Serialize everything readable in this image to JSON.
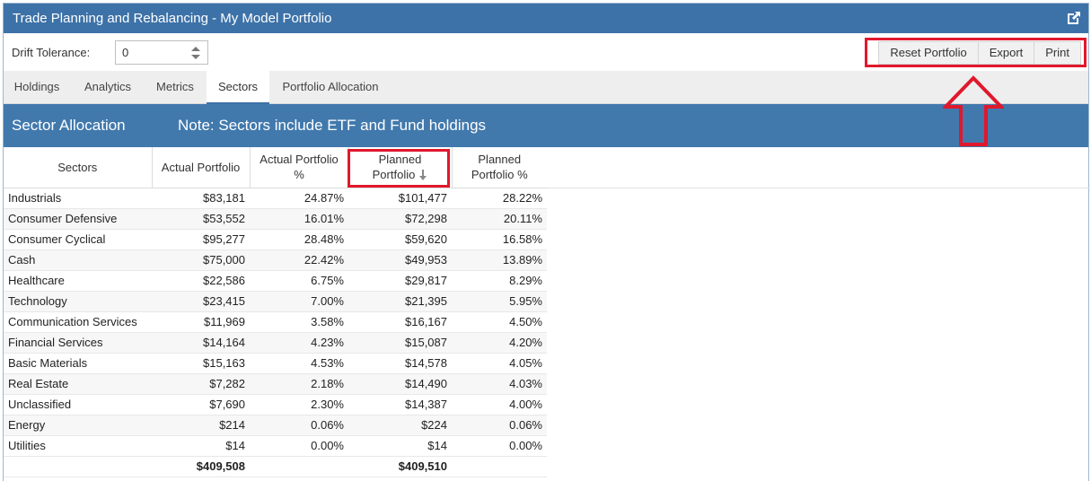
{
  "window": {
    "title": "Trade Planning and Rebalancing - My Model Portfolio"
  },
  "toolbar": {
    "drift_label": "Drift Tolerance:",
    "drift_value": "0",
    "buttons": [
      "Reset Portfolio",
      "Export",
      "Print"
    ]
  },
  "tabs": [
    "Holdings",
    "Analytics",
    "Metrics",
    "Sectors",
    "Portfolio Allocation"
  ],
  "active_tab": "Sectors",
  "section": {
    "title": "Sector Allocation",
    "note": "Note: Sectors include ETF and Fund holdings"
  },
  "table": {
    "headers": [
      "Sectors",
      "Actual Portfolio",
      "Actual Portfolio %",
      "Planned Portfolio",
      "Planned Portfolio %"
    ],
    "sort": {
      "column": "Planned Portfolio",
      "direction": "descending"
    },
    "rows": [
      [
        "Industrials",
        "$83,181",
        "24.87%",
        "$101,477",
        "28.22%"
      ],
      [
        "Consumer Defensive",
        "$53,552",
        "16.01%",
        "$72,298",
        "20.11%"
      ],
      [
        "Consumer Cyclical",
        "$95,277",
        "28.48%",
        "$59,620",
        "16.58%"
      ],
      [
        "Cash",
        "$75,000",
        "22.42%",
        "$49,953",
        "13.89%"
      ],
      [
        "Healthcare",
        "$22,586",
        "6.75%",
        "$29,817",
        "8.29%"
      ],
      [
        "Technology",
        "$23,415",
        "7.00%",
        "$21,395",
        "5.95%"
      ],
      [
        "Communication Services",
        "$11,969",
        "3.58%",
        "$16,167",
        "4.50%"
      ],
      [
        "Financial Services",
        "$14,164",
        "4.23%",
        "$15,087",
        "4.20%"
      ],
      [
        "Basic Materials",
        "$15,163",
        "4.53%",
        "$14,578",
        "4.05%"
      ],
      [
        "Real Estate",
        "$7,282",
        "2.18%",
        "$14,490",
        "4.03%"
      ],
      [
        "Unclassified",
        "$7,690",
        "2.30%",
        "$14,387",
        "4.00%"
      ],
      [
        "Energy",
        "$214",
        "0.06%",
        "$224",
        "0.06%"
      ],
      [
        "Utilities",
        "$14",
        "0.00%",
        "$14",
        "0.00%"
      ]
    ],
    "totals": [
      "",
      "$409,508",
      "",
      "$409,510",
      ""
    ]
  },
  "colors": {
    "header_blue": "#3d72a8",
    "section_blue": "#4179ad",
    "annotation_red": "#e0182c"
  },
  "icons": [
    "popout-icon",
    "spinner-icon",
    "sort-descending-icon",
    "annotation-arrow"
  ]
}
